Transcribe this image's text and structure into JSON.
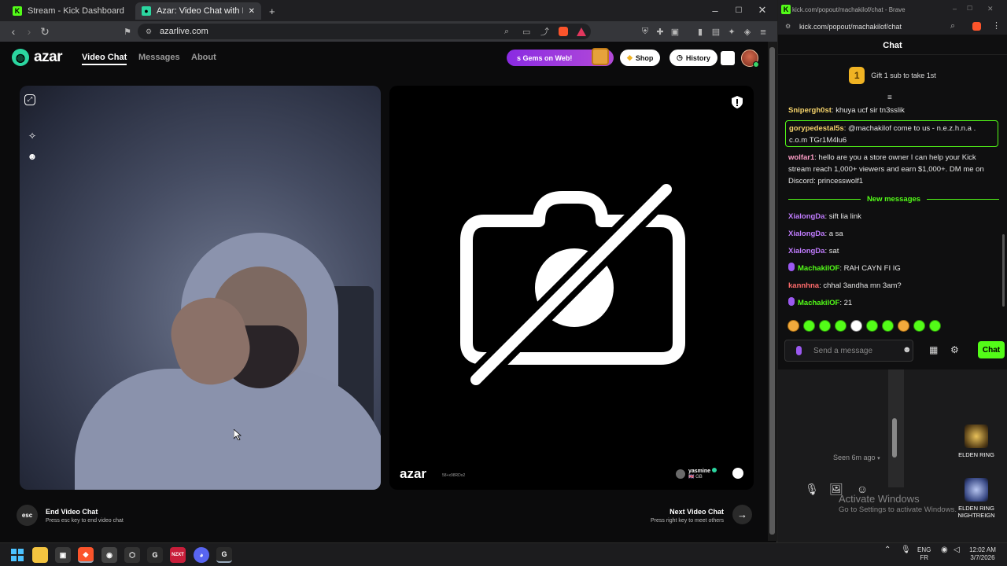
{
  "browser": {
    "tabs": [
      {
        "label": "Stream - Kick Dashboard",
        "active": false
      },
      {
        "label": "Azar: Video Chat with New Pe",
        "active": true
      }
    ],
    "new_tab": "+",
    "url": "azarlive.com",
    "window_controls": [
      "–",
      "☐",
      "✕"
    ]
  },
  "site": {
    "logo": "azar",
    "nav": [
      "Video Chat",
      "Messages",
      "About"
    ],
    "gems_label": "s Gems on Web!",
    "shop_label": "Shop",
    "history_label": "History",
    "accent_color": "#2bd6a0"
  },
  "video": {
    "watermark": "azar",
    "watermark_sub": "58+x98RDo2",
    "partner_name": "yasmine",
    "partner_country": "🇬🇧 GB"
  },
  "controls": {
    "esc_key": "esc",
    "end_title": "End Video Chat",
    "end_hint": "Press esc key to end video chat",
    "next_title": "Next Video Chat",
    "next_hint": "Press right key to meet others",
    "next_arrow": "→"
  },
  "chat_window": {
    "title": "kick.com/popout/machakilof/chat - Brave",
    "url": "kick.com/popout/machakilof/chat",
    "header": "Chat",
    "gift_badge": "1",
    "gift_text": "Gift 1 sub to take 1st",
    "new_messages_label": "New messages",
    "input_placeholder": "Send a message",
    "send_label": "Chat",
    "accent_color": "#53fc18",
    "messages": [
      {
        "user": "Snipergh0st",
        "text": "khuya ucf sir tn3sslik",
        "color": "#f5d36b"
      },
      {
        "user": "gorypedestal5s",
        "text": "@machakilof come to us - n.e.z.h.n.a . c.o.m TGr1M4lu6",
        "color": "#f5d36b"
      },
      {
        "user": "wolfar1",
        "text": "hello are you a store owner I can help your Kick stream reach 1,000+ viewers and earn $1,000+. DM me on Discord: princesswolf1",
        "color": "#ff9ec7"
      },
      {
        "user": "XialongDa",
        "text": "sift lia link",
        "color": "#c17cff"
      },
      {
        "user": "XialongDa",
        "text": "a sa",
        "color": "#c17cff"
      },
      {
        "user": "XialongDa",
        "text": "sat",
        "color": "#c17cff"
      },
      {
        "user": "MachakilOF",
        "text": "RAH CAYN FI IG",
        "color": "#53fc18"
      },
      {
        "user": "kannhna",
        "text": "chhal 3andha mn 3am?",
        "color": "#ff6b6b"
      },
      {
        "user": "MachakilOF",
        "text": "21",
        "color": "#53fc18"
      }
    ]
  },
  "background_app": {
    "seen": "Seen 6m ago",
    "activate_title": "Activate Windows",
    "activate_sub": "Go to Settings to activate Windows.",
    "desktop_icons": [
      "ELDEN RING",
      "ELDEN RING NIGHTREIGN"
    ]
  },
  "taskbar": {
    "lang_top": "ENG",
    "lang_bottom": "FR",
    "time": "12:02 AM",
    "date": "3/7/2026"
  }
}
